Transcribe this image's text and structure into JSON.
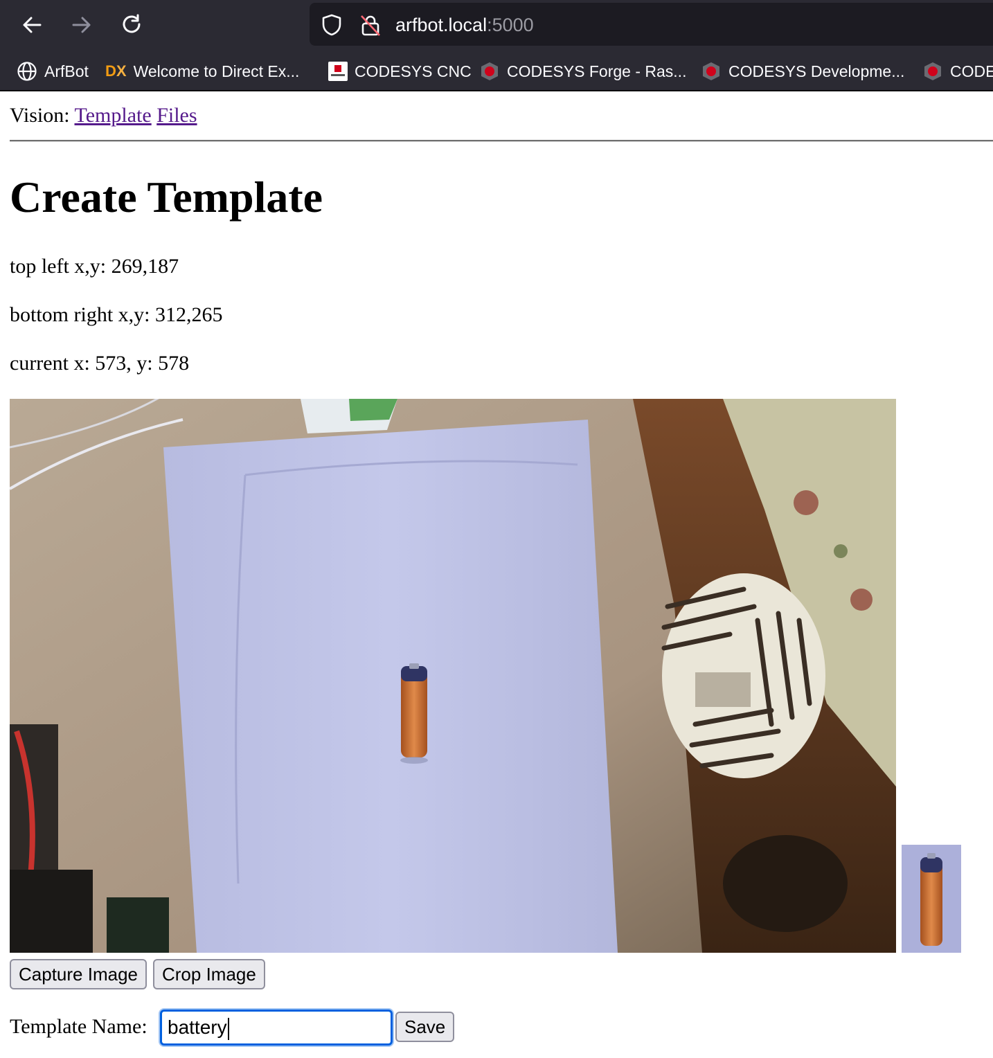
{
  "browser": {
    "url_host": "arfbot.local",
    "url_port": ":5000",
    "bookmarks": [
      {
        "label": "ArfBot",
        "icon": "globe-icon"
      },
      {
        "label": "Welcome to Direct Ex...",
        "icon": "dx-logo-icon"
      },
      {
        "label": "CODESYS CNC",
        "icon": "codesys-logo-icon"
      },
      {
        "label": "CODESYS Forge - Ras...",
        "icon": "codesys-forge-icon"
      },
      {
        "label": "CODESYS Developme...",
        "icon": "codesys-forge-icon"
      },
      {
        "label": "CODE",
        "icon": "codesys-forge-icon"
      }
    ],
    "colors": {
      "toolbar": "#2b2a33",
      "urlbar": "#1c1b22",
      "dx_orange": "#f39c12",
      "codesys_red": "#d0021b"
    }
  },
  "page": {
    "nav_prefix": "Vision:",
    "nav_links": [
      "Template",
      "Files"
    ],
    "title": "Create Template",
    "top_left_text": "top left x,y: 269,187",
    "bottom_right_text": "bottom right x,y: 312,265",
    "current_text": "current x: 573, y: 578",
    "buttons": {
      "capture": "Capture Image",
      "crop": "Crop Image",
      "save": "Save"
    },
    "template_name_label": "Template Name:",
    "template_name_value": "battery"
  },
  "colors": {
    "link_visited": "#551a8b",
    "focus_blue": "#0060df",
    "button_bg": "#e9e9ed"
  }
}
